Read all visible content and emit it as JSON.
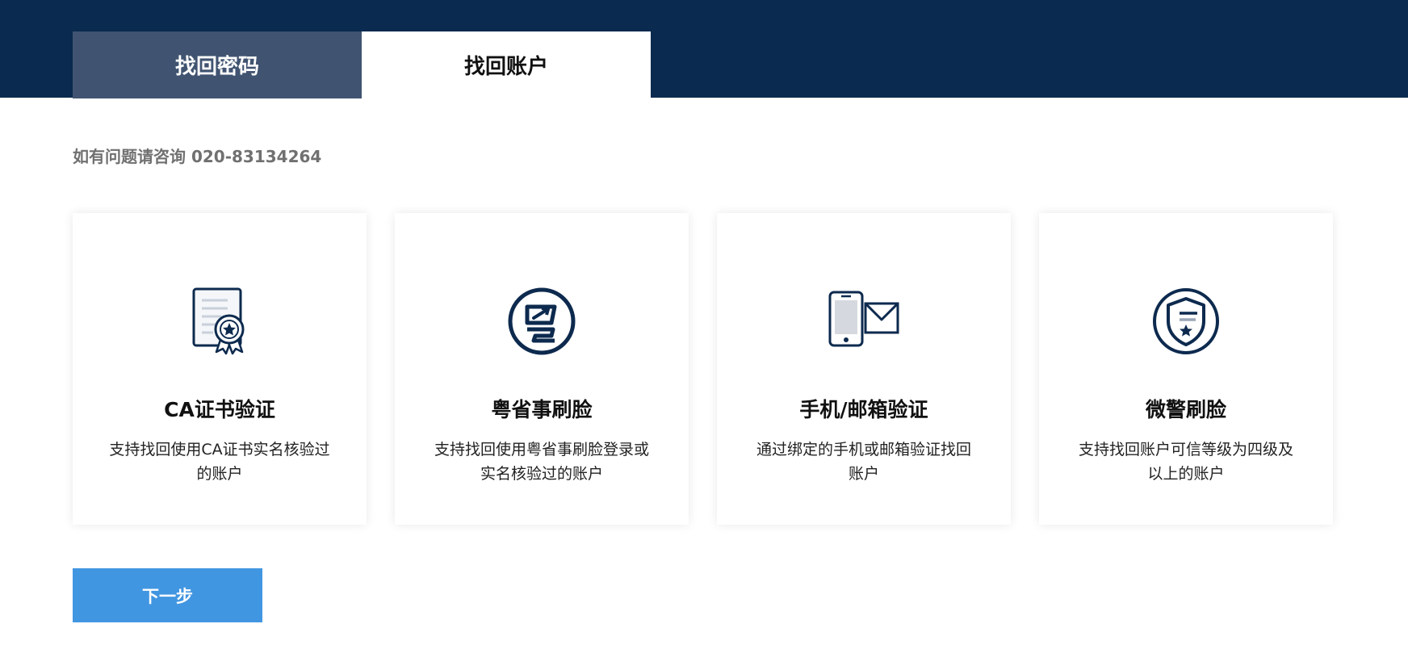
{
  "tabs": [
    {
      "label": "找回密码",
      "active": false
    },
    {
      "label": "找回账户",
      "active": true
    }
  ],
  "contact": {
    "text": "如有问题请咨询 020-83134264"
  },
  "cards": [
    {
      "icon": "certificate-icon",
      "title": "CA证书验证",
      "desc": "支持找回使用CA证书实名核验过的账户"
    },
    {
      "icon": "yueshengshi-logo-icon",
      "title": "粤省事刷脸",
      "desc": "支持找回使用粤省事刷脸登录或实名核验过的账户"
    },
    {
      "icon": "phone-mail-icon",
      "title": "手机/邮箱验证",
      "desc": "通过绑定的手机或邮箱验证找回账户"
    },
    {
      "icon": "police-shield-icon",
      "title": "微警刷脸",
      "desc": "支持找回账户可信等级为四级及以上的账户"
    }
  ],
  "next_button": {
    "label": "下一步"
  },
  "colors": {
    "header": "#0a2a4f",
    "tab_inactive": "#405471",
    "icon_navy": "#0d2a4e",
    "button": "#4196e1"
  }
}
